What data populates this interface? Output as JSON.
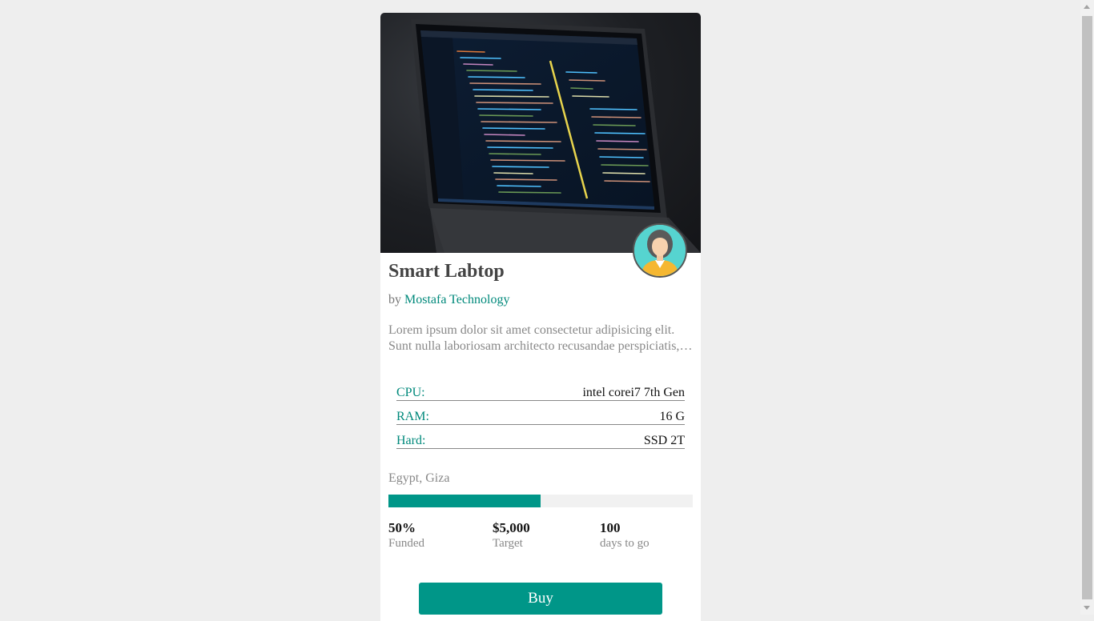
{
  "product": {
    "title": "Smart Labtop",
    "by_prefix": "by",
    "vendor": "Mostafa Technology",
    "description_line1": "Lorem ipsum dolor sit amet consectetur adipisicing elit.",
    "description_line2": "Sunt nulla laboriosam architecto recusandae perspiciatis, voluptatem"
  },
  "specs": [
    {
      "key": "CPU:",
      "value": "intel corei7 7th Gen"
    },
    {
      "key": "RAM:",
      "value": "16 G"
    },
    {
      "key": "Hard:",
      "value": "SSD 2T"
    }
  ],
  "location": "Egypt, Giza",
  "funding": {
    "progress_fraction": 0.5,
    "funded_value": "50%",
    "funded_label": "Funded",
    "target_value": "$5,000",
    "target_label": "Target",
    "days_value": "100",
    "days_label": "days to go"
  },
  "actions": {
    "buy_label": "Buy"
  },
  "icons": {
    "avatar": "user-avatar-icon",
    "hero": "laptop-code-image"
  },
  "colors": {
    "accent": "#009688",
    "link": "#00897b",
    "background": "#eeeeee"
  }
}
